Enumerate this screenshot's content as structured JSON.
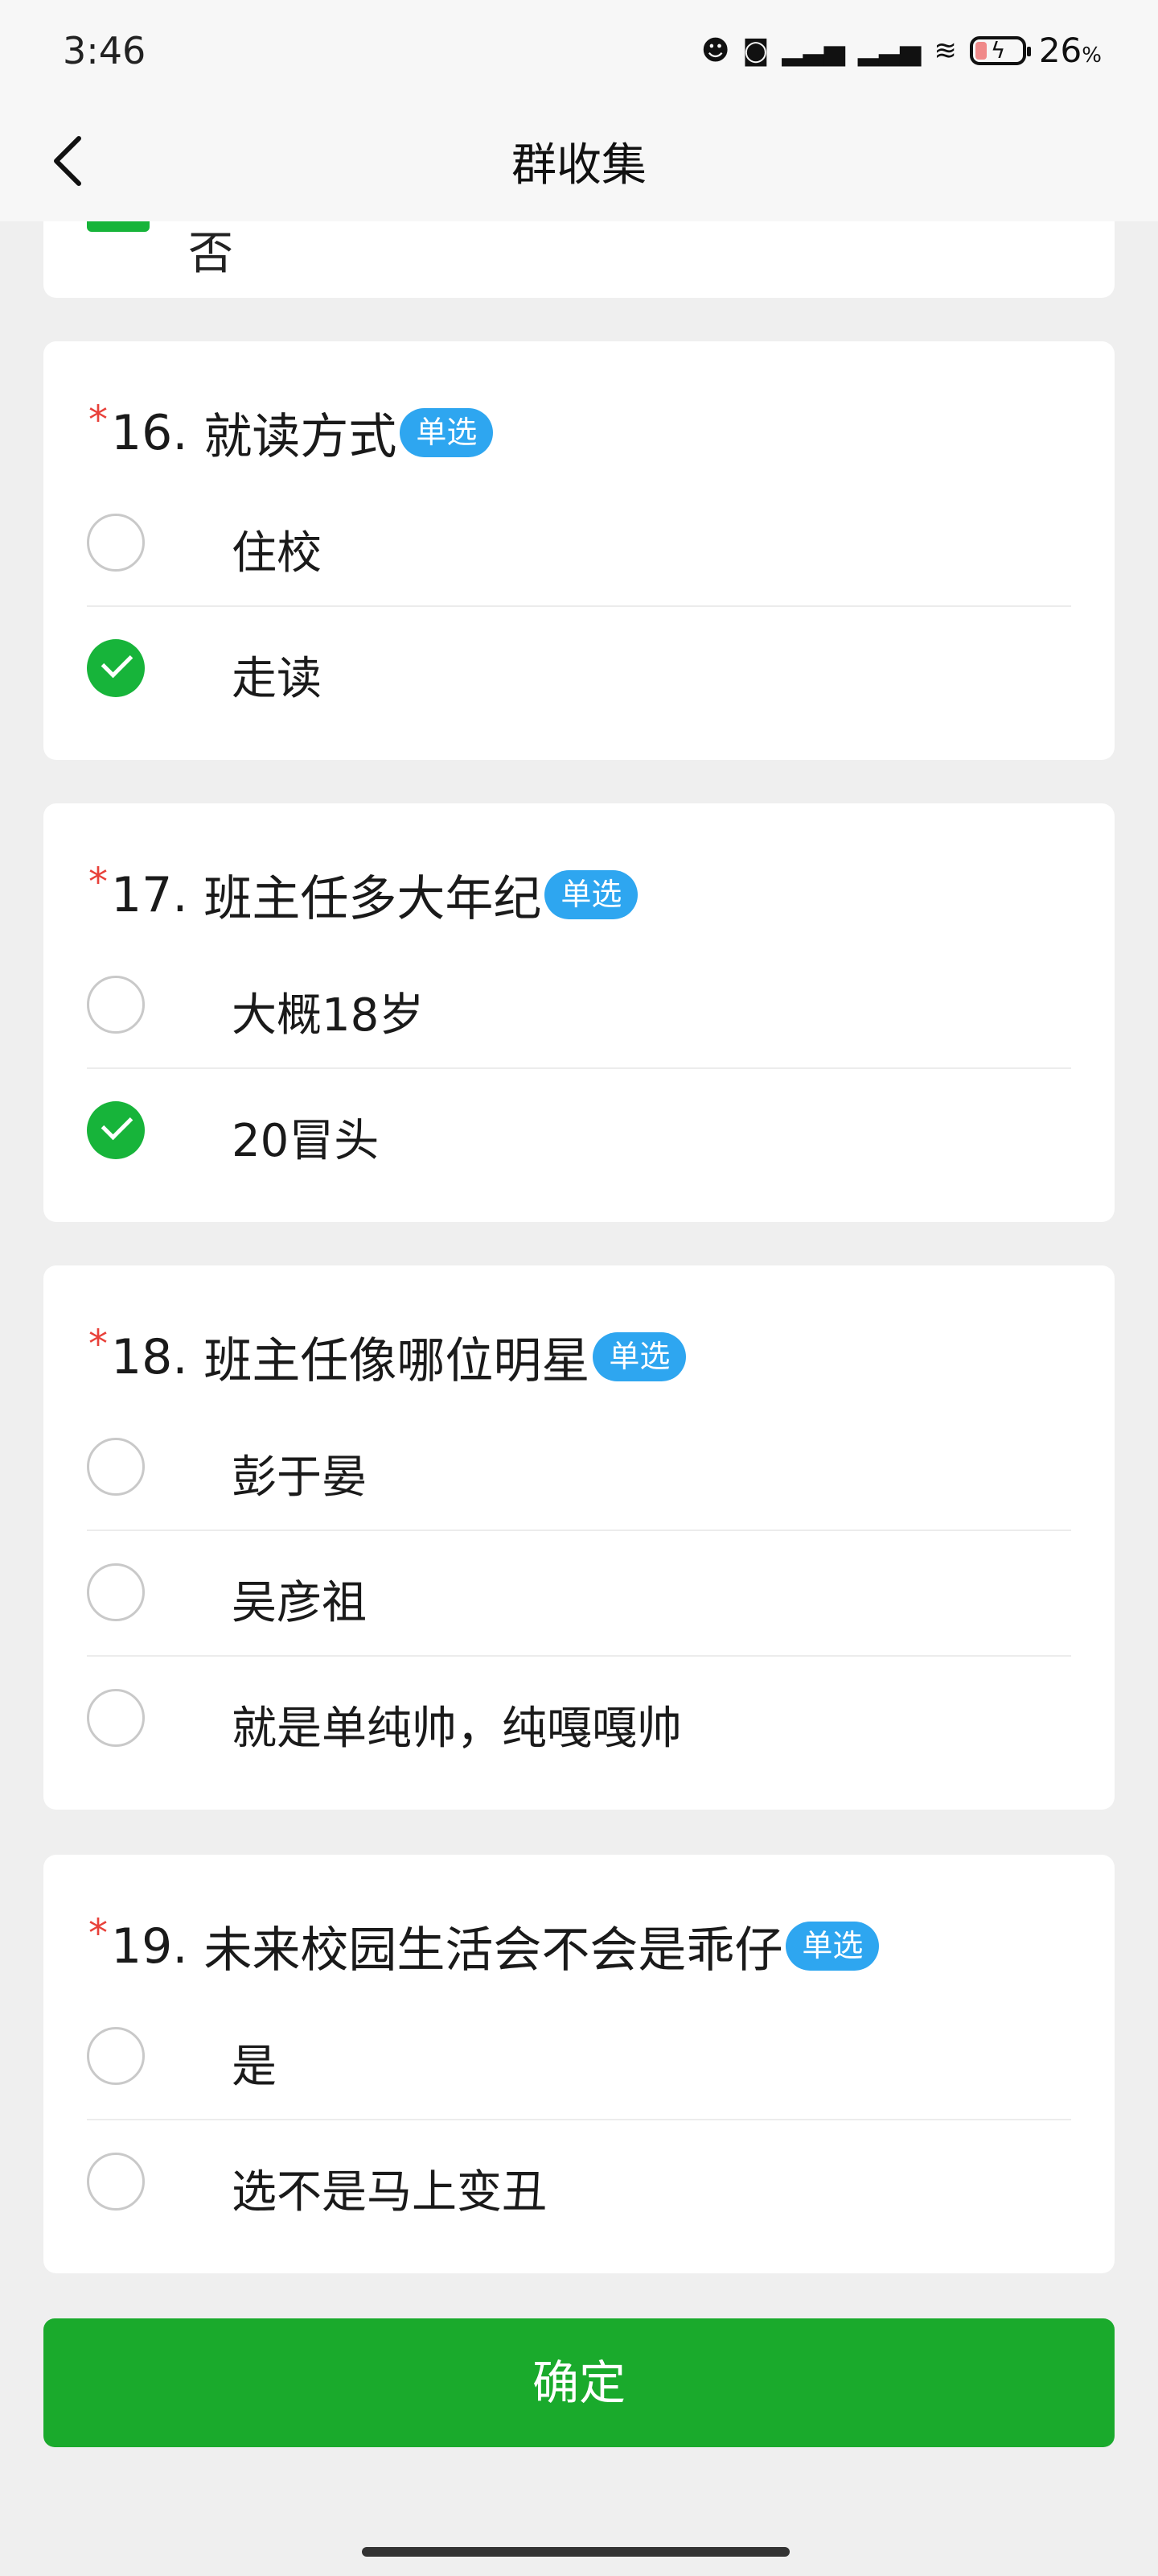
{
  "status_bar": {
    "time": "3:46",
    "battery_percent": "26",
    "battery_unit": "%",
    "icons": [
      "notification-icon",
      "headset-icon",
      "signal-hd-icon",
      "signal-hd-icon",
      "wifi-icon",
      "battery-icon"
    ]
  },
  "header": {
    "title": "群收集"
  },
  "previous_partial": {
    "option_label": "否"
  },
  "questions": [
    {
      "required_mark": "*",
      "number": "16.",
      "title": "就读方式",
      "badge": "单选",
      "options": [
        {
          "label": "住校",
          "selected": false
        },
        {
          "label": "走读",
          "selected": true
        }
      ]
    },
    {
      "required_mark": "*",
      "number": "17.",
      "title": "班主任多大年纪",
      "badge": "单选",
      "options": [
        {
          "label": "大概18岁",
          "selected": false
        },
        {
          "label": "20冒头",
          "selected": true
        }
      ]
    },
    {
      "required_mark": "*",
      "number": "18.",
      "title": "班主任像哪位明星",
      "badge": "单选",
      "options": [
        {
          "label": "彭于晏",
          "selected": false
        },
        {
          "label": "吴彦祖",
          "selected": false
        },
        {
          "label": "就是单纯帅，纯嘎嘎帅",
          "selected": false
        }
      ]
    },
    {
      "required_mark": "*",
      "number": "19.",
      "title": "未来校园生活会不会是乖仔",
      "badge": "单选",
      "options": [
        {
          "label": "是",
          "selected": false
        },
        {
          "label": "选不是马上变丑",
          "selected": false
        }
      ]
    }
  ],
  "footer": {
    "confirm_label": "确定"
  },
  "colors": {
    "accent_green": "#17b43a",
    "button_green": "#1aaa2c",
    "badge_blue": "#2ea6f0",
    "required_red": "#e8413a"
  }
}
